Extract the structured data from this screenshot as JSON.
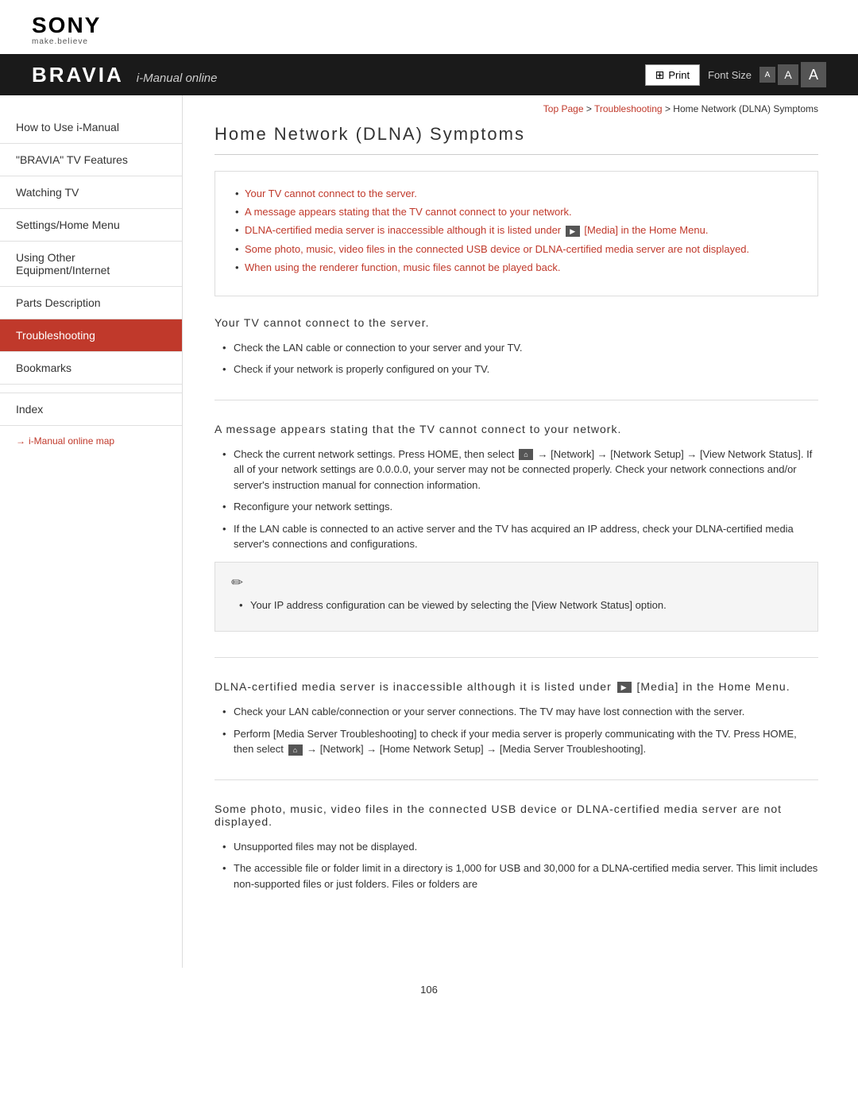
{
  "header": {
    "sony_text": "SONY",
    "sony_tagline": "make.believe",
    "bravia_logo": "BRAVIA",
    "bravia_subtitle": "i-Manual online",
    "print_label": "Print",
    "font_size_label": "Font Size",
    "font_btn_sm": "A",
    "font_btn_md": "A",
    "font_btn_lg": "A"
  },
  "breadcrumb": {
    "top_page": "Top Page",
    "separator1": " > ",
    "troubleshooting": "Troubleshooting",
    "separator2": " > ",
    "current": "Home Network (DLNA) Symptoms"
  },
  "sidebar": {
    "items": [
      {
        "label": "How to Use i-Manual",
        "active": false
      },
      {
        "label": "\"BRAVIA\" TV Features",
        "active": false
      },
      {
        "label": "Watching TV",
        "active": false
      },
      {
        "label": "Settings/Home Menu",
        "active": false
      },
      {
        "label": "Using Other Equipment/Internet",
        "active": false
      },
      {
        "label": "Parts Description",
        "active": false
      },
      {
        "label": "Troubleshooting",
        "active": true
      },
      {
        "label": "Bookmarks",
        "active": false
      }
    ],
    "index_label": "Index",
    "map_link": "i-Manual online map"
  },
  "page": {
    "title": "Home Network (DLNA) Symptoms",
    "summary_links": [
      "Your TV cannot connect to the server.",
      "A message appears stating that the TV cannot connect to your network.",
      "DLNA-certified media server is inaccessible although it is listed under  [Media] in the Home Menu.",
      "Some photo, music, video files in the connected USB device or DLNA-certified media server are not displayed.",
      "When using the renderer function, music files cannot be played back."
    ],
    "sections": [
      {
        "id": "section1",
        "title": "Your TV cannot connect to the server.",
        "bullets": [
          "Check the LAN cable or connection to your server and your TV.",
          "Check if your network is properly configured on your TV."
        ]
      },
      {
        "id": "section2",
        "title": "A message appears stating that the TV cannot connect to your network.",
        "bullets": [
          "Check the current network settings. Press HOME, then select  → [Network] → [Network Setup] → [View Network Status]. If all of your network settings are 0.0.0.0, your server may not be connected properly. Check your network connections and/or server's instruction manual for connection information.",
          "Reconfigure your network settings.",
          "If the LAN cable is connected to an active server and the TV has acquired an IP address, check your DLNA-certified media server's connections and configurations."
        ],
        "note": "Your IP address configuration can be viewed by selecting the [View Network Status] option."
      },
      {
        "id": "section3",
        "title_pre": "DLNA-certified media server is inaccessible although it is listed under",
        "title_mid": "[Media]",
        "title_post": "in the Home Menu.",
        "bullets": [
          "Check your LAN cable/connection or your server connections. The TV may have lost connection with the server.",
          "Perform [Media Server Troubleshooting] to check if your media server is properly communicating with the TV. Press HOME, then select  → [Network] → [Home Network Setup] → [Media Server Troubleshooting]."
        ]
      },
      {
        "id": "section4",
        "title": "Some photo, music, video files in the connected USB device or DLNA-certified media server are not displayed.",
        "bullets": [
          "Unsupported files may not be displayed.",
          "The accessible file or folder limit in a directory is 1,000 for USB and 30,000 for a DLNA-certified media server. This limit includes non-supported files or just folders. Files or folders are"
        ]
      }
    ],
    "page_number": "106"
  }
}
